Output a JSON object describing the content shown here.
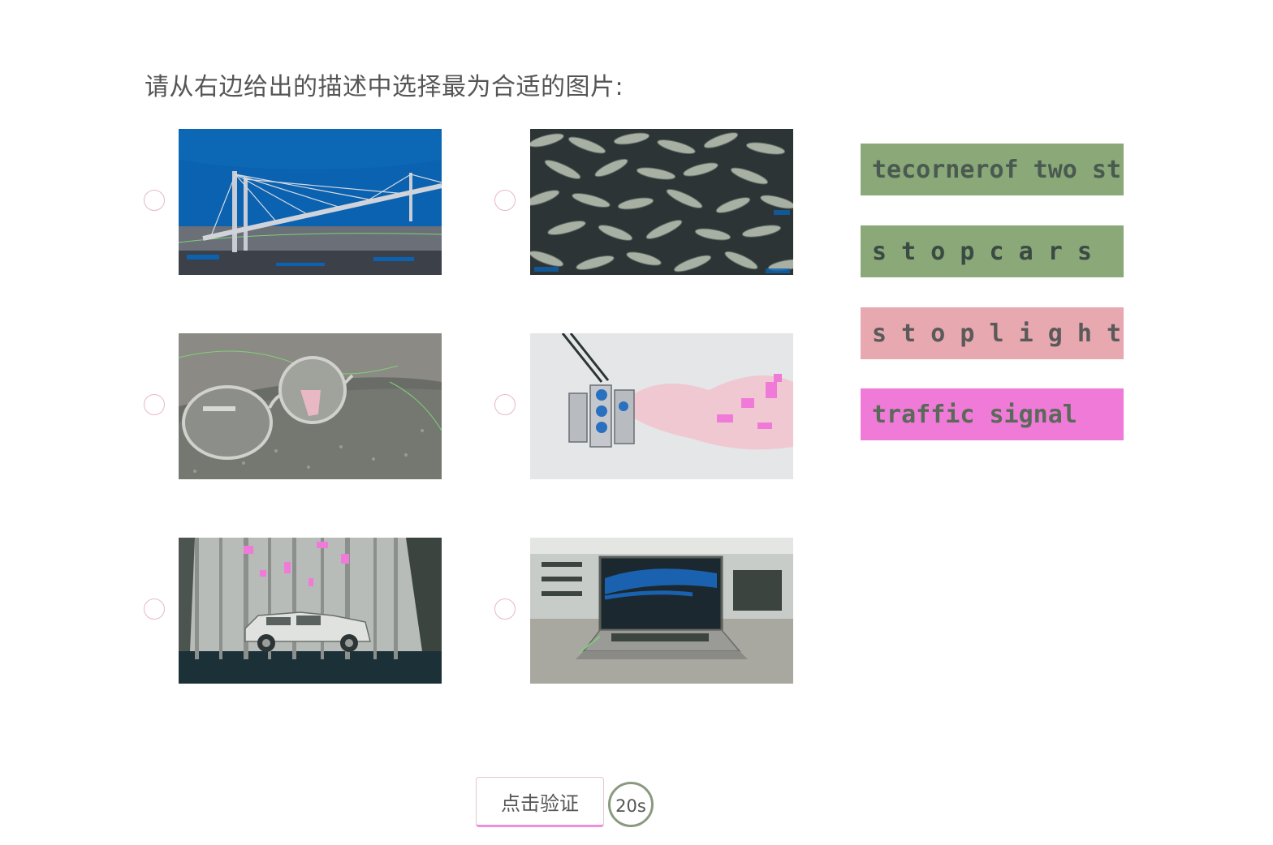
{
  "prompt": "请从右边给出的描述中选择最为合适的图片:",
  "options": [
    {
      "id": "bridge",
      "image": "suspension-bridge-image"
    },
    {
      "id": "fish",
      "image": "fish-pile-image"
    },
    {
      "id": "glasses",
      "image": "eyeglasses-image"
    },
    {
      "id": "traffic-light",
      "image": "traffic-light-image"
    },
    {
      "id": "car-forest",
      "image": "car-in-forest-image"
    },
    {
      "id": "laptop",
      "image": "laptop-on-table-image"
    }
  ],
  "captions": [
    {
      "text": "tecornerof two streets",
      "bg": "#8aa878",
      "color": "#4a5a50"
    },
    {
      "text": "s t o p   c a r s",
      "bg": "#8aa878",
      "color": "#3c4a44"
    },
    {
      "text": "s t o p l i g h t",
      "bg": "#e8a8b0",
      "color": "#5a5a5a"
    },
    {
      "text": "traffic signal",
      "bg": "#f07ad8",
      "color": "#5a6a58"
    }
  ],
  "verify_label": "点击验证",
  "timer": "20s",
  "colors": {
    "radio_border": "#e8b8c4",
    "button_accent": "#ee8fdc",
    "timer_ring": "#8a9a80"
  }
}
